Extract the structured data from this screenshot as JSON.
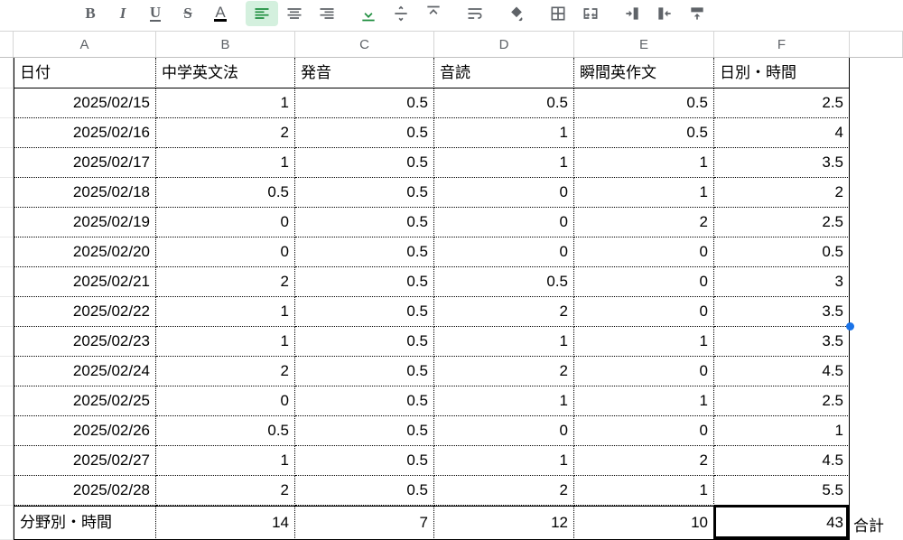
{
  "columns": [
    "A",
    "B",
    "C",
    "D",
    "E",
    "F"
  ],
  "headers": [
    "日付",
    "中学英文法",
    "発音",
    "音読",
    "瞬間英作文",
    "日別・時間"
  ],
  "rows": [
    {
      "date": "2025/02/15",
      "b": "1",
      "c": "0.5",
      "d": "0.5",
      "e": "0.5",
      "f": "2.5"
    },
    {
      "date": "2025/02/16",
      "b": "2",
      "c": "0.5",
      "d": "1",
      "e": "0.5",
      "f": "4"
    },
    {
      "date": "2025/02/17",
      "b": "1",
      "c": "0.5",
      "d": "1",
      "e": "1",
      "f": "3.5"
    },
    {
      "date": "2025/02/18",
      "b": "0.5",
      "c": "0.5",
      "d": "0",
      "e": "1",
      "f": "2"
    },
    {
      "date": "2025/02/19",
      "b": "0",
      "c": "0.5",
      "d": "0",
      "e": "2",
      "f": "2.5"
    },
    {
      "date": "2025/02/20",
      "b": "0",
      "c": "0.5",
      "d": "0",
      "e": "0",
      "f": "0.5"
    },
    {
      "date": "2025/02/21",
      "b": "2",
      "c": "0.5",
      "d": "0.5",
      "e": "0",
      "f": "3"
    },
    {
      "date": "2025/02/22",
      "b": "1",
      "c": "0.5",
      "d": "2",
      "e": "0",
      "f": "3.5"
    },
    {
      "date": "2025/02/23",
      "b": "1",
      "c": "0.5",
      "d": "1",
      "e": "1",
      "f": "3.5"
    },
    {
      "date": "2025/02/24",
      "b": "2",
      "c": "0.5",
      "d": "2",
      "e": "0",
      "f": "4.5"
    },
    {
      "date": "2025/02/25",
      "b": "0",
      "c": "0.5",
      "d": "1",
      "e": "1",
      "f": "2.5"
    },
    {
      "date": "2025/02/26",
      "b": "0.5",
      "c": "0.5",
      "d": "0",
      "e": "0",
      "f": "1"
    },
    {
      "date": "2025/02/27",
      "b": "1",
      "c": "0.5",
      "d": "1",
      "e": "2",
      "f": "4.5"
    },
    {
      "date": "2025/02/28",
      "b": "2",
      "c": "0.5",
      "d": "2",
      "e": "1",
      "f": "5.5"
    }
  ],
  "totals": {
    "label": "分野別・時間",
    "b": "14",
    "c": "7",
    "d": "12",
    "e": "10",
    "f": "43"
  },
  "totals_outside_label": "合計",
  "chart_data": {
    "type": "table",
    "title": "",
    "columns": [
      "日付",
      "中学英文法",
      "発音",
      "音読",
      "瞬間英作文",
      "日別・時間"
    ],
    "data": [
      [
        "2025/02/15",
        1,
        0.5,
        0.5,
        0.5,
        2.5
      ],
      [
        "2025/02/16",
        2,
        0.5,
        1,
        0.5,
        4
      ],
      [
        "2025/02/17",
        1,
        0.5,
        1,
        1,
        3.5
      ],
      [
        "2025/02/18",
        0.5,
        0.5,
        0,
        1,
        2
      ],
      [
        "2025/02/19",
        0,
        0.5,
        0,
        2,
        2.5
      ],
      [
        "2025/02/20",
        0,
        0.5,
        0,
        0,
        0.5
      ],
      [
        "2025/02/21",
        2,
        0.5,
        0.5,
        0,
        3
      ],
      [
        "2025/02/22",
        1,
        0.5,
        2,
        0,
        3.5
      ],
      [
        "2025/02/23",
        1,
        0.5,
        1,
        1,
        3.5
      ],
      [
        "2025/02/24",
        2,
        0.5,
        2,
        0,
        4.5
      ],
      [
        "2025/02/25",
        0,
        0.5,
        1,
        1,
        2.5
      ],
      [
        "2025/02/26",
        0.5,
        0.5,
        0,
        0,
        1
      ],
      [
        "2025/02/27",
        1,
        0.5,
        1,
        2,
        4.5
      ],
      [
        "2025/02/28",
        2,
        0.5,
        2,
        1,
        5.5
      ]
    ],
    "totals_row": [
      "分野別・時間",
      14,
      7,
      12,
      10,
      43
    ]
  }
}
